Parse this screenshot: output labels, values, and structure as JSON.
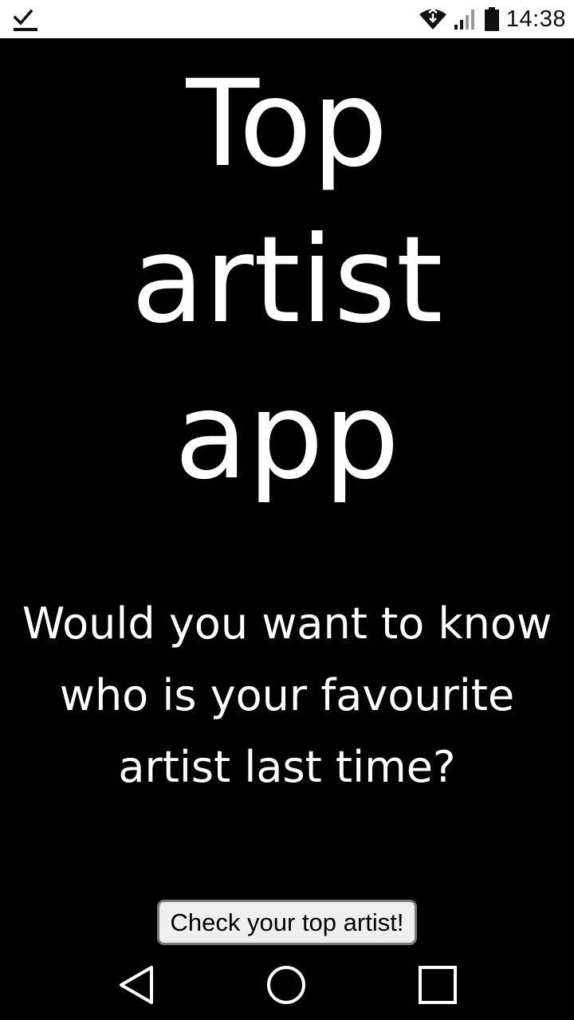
{
  "status_bar": {
    "time": "14:38",
    "icons": [
      "download-done-icon",
      "wifi-icon",
      "cell-signal-icon",
      "battery-icon"
    ]
  },
  "main": {
    "title_lines": [
      "Top",
      "artist",
      "app"
    ],
    "question": "Would you want to know who is your favourite artist last time?",
    "button_label": "Check your top artist!"
  },
  "nav_bar": {
    "icons": [
      "back-icon",
      "home-icon",
      "recents-icon"
    ]
  },
  "colors": {
    "background": "#000000",
    "status_bar_bg": "#ffffff",
    "text": "#ffffff",
    "button_bg": "#efefef",
    "button_border": "#7a7a7a"
  }
}
